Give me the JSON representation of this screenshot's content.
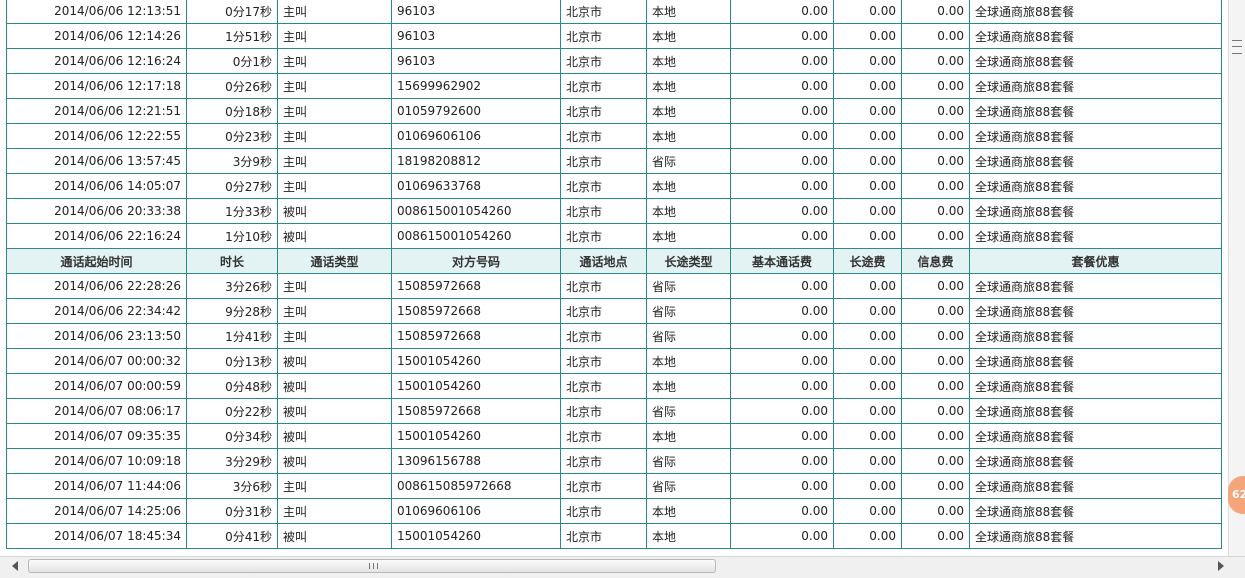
{
  "header": [
    "通话起始时间",
    "时长",
    "通话类型",
    "对方号码",
    "通话地点",
    "长途类型",
    "基本通话费",
    "长途费",
    "信息费",
    "套餐优惠"
  ],
  "rows_top": [
    [
      "2014/06/06 12:13:51",
      "0分17秒",
      "主叫",
      "96103",
      "北京市",
      "本地",
      "0.00",
      "0.00",
      "0.00",
      "全球通商旅88套餐"
    ],
    [
      "2014/06/06 12:14:26",
      "1分51秒",
      "主叫",
      "96103",
      "北京市",
      "本地",
      "0.00",
      "0.00",
      "0.00",
      "全球通商旅88套餐"
    ],
    [
      "2014/06/06 12:16:24",
      "0分1秒",
      "主叫",
      "96103",
      "北京市",
      "本地",
      "0.00",
      "0.00",
      "0.00",
      "全球通商旅88套餐"
    ],
    [
      "2014/06/06 12:17:18",
      "0分26秒",
      "主叫",
      "15699962902",
      "北京市",
      "本地",
      "0.00",
      "0.00",
      "0.00",
      "全球通商旅88套餐"
    ],
    [
      "2014/06/06 12:21:51",
      "0分18秒",
      "主叫",
      "01059792600",
      "北京市",
      "本地",
      "0.00",
      "0.00",
      "0.00",
      "全球通商旅88套餐"
    ],
    [
      "2014/06/06 12:22:55",
      "0分23秒",
      "主叫",
      "01069606106",
      "北京市",
      "本地",
      "0.00",
      "0.00",
      "0.00",
      "全球通商旅88套餐"
    ],
    [
      "2014/06/06 13:57:45",
      "3分9秒",
      "主叫",
      "18198208812",
      "北京市",
      "省际",
      "0.00",
      "0.00",
      "0.00",
      "全球通商旅88套餐"
    ],
    [
      "2014/06/06 14:05:07",
      "0分27秒",
      "主叫",
      "01069633768",
      "北京市",
      "本地",
      "0.00",
      "0.00",
      "0.00",
      "全球通商旅88套餐"
    ],
    [
      "2014/06/06 20:33:38",
      "1分33秒",
      "被叫",
      "008615001054260",
      "北京市",
      "本地",
      "0.00",
      "0.00",
      "0.00",
      "全球通商旅88套餐"
    ],
    [
      "2014/06/06 22:16:24",
      "1分10秒",
      "被叫",
      "008615001054260",
      "北京市",
      "本地",
      "0.00",
      "0.00",
      "0.00",
      "全球通商旅88套餐"
    ]
  ],
  "rows_bottom": [
    [
      "2014/06/06 22:28:26",
      "3分26秒",
      "主叫",
      "15085972668",
      "北京市",
      "省际",
      "0.00",
      "0.00",
      "0.00",
      "全球通商旅88套餐"
    ],
    [
      "2014/06/06 22:34:42",
      "9分28秒",
      "主叫",
      "15085972668",
      "北京市",
      "省际",
      "0.00",
      "0.00",
      "0.00",
      "全球通商旅88套餐"
    ],
    [
      "2014/06/06 23:13:50",
      "1分41秒",
      "主叫",
      "15085972668",
      "北京市",
      "省际",
      "0.00",
      "0.00",
      "0.00",
      "全球通商旅88套餐"
    ],
    [
      "2014/06/07 00:00:32",
      "0分13秒",
      "被叫",
      "15001054260",
      "北京市",
      "本地",
      "0.00",
      "0.00",
      "0.00",
      "全球通商旅88套餐"
    ],
    [
      "2014/06/07 00:00:59",
      "0分48秒",
      "被叫",
      "15001054260",
      "北京市",
      "本地",
      "0.00",
      "0.00",
      "0.00",
      "全球通商旅88套餐"
    ],
    [
      "2014/06/07 08:06:17",
      "0分22秒",
      "被叫",
      "15085972668",
      "北京市",
      "省际",
      "0.00",
      "0.00",
      "0.00",
      "全球通商旅88套餐"
    ],
    [
      "2014/06/07 09:35:35",
      "0分34秒",
      "被叫",
      "15001054260",
      "北京市",
      "本地",
      "0.00",
      "0.00",
      "0.00",
      "全球通商旅88套餐"
    ],
    [
      "2014/06/07 10:09:18",
      "3分29秒",
      "被叫",
      "13096156788",
      "北京市",
      "省际",
      "0.00",
      "0.00",
      "0.00",
      "全球通商旅88套餐"
    ],
    [
      "2014/06/07 11:44:06",
      "3分6秒",
      "主叫",
      "008615085972668",
      "北京市",
      "省际",
      "0.00",
      "0.00",
      "0.00",
      "全球通商旅88套餐"
    ],
    [
      "2014/06/07 14:25:06",
      "0分31秒",
      "主叫",
      "01069606106",
      "北京市",
      "本地",
      "0.00",
      "0.00",
      "0.00",
      "全球通商旅88套餐"
    ],
    [
      "2014/06/07 18:45:34",
      "0分41秒",
      "被叫",
      "15001054260",
      "北京市",
      "本地",
      "0.00",
      "0.00",
      "0.00",
      "全球通商旅88套餐"
    ]
  ],
  "side_badge": "62",
  "scroll_grip": "III",
  "colors": {
    "border": "#2b8a88",
    "header_bg": "#e3f3f3"
  }
}
